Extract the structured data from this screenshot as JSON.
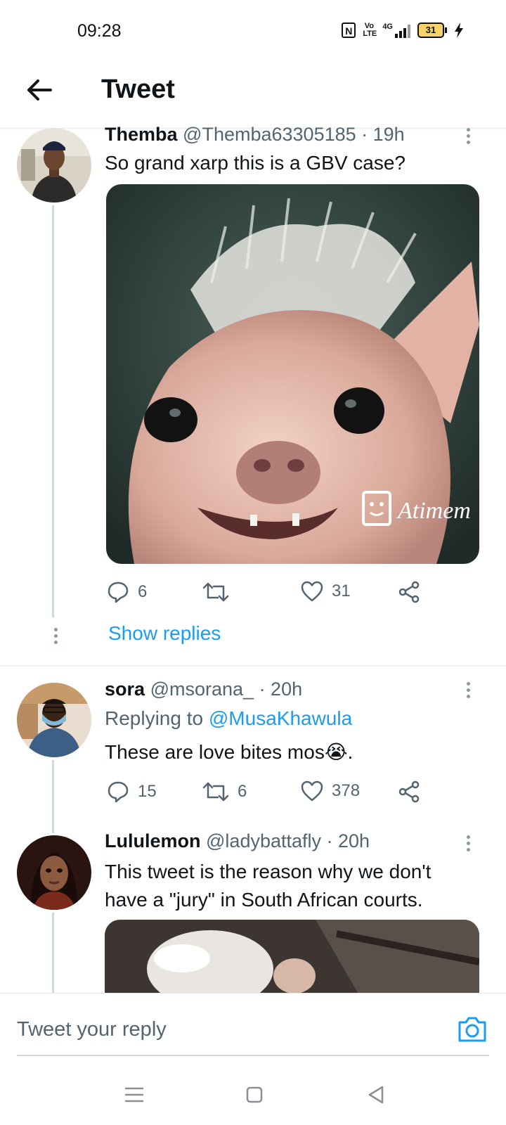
{
  "status_bar": {
    "time": "09:28",
    "nfc_label": "N",
    "volte_label": "Vo LTE",
    "network_label": "4G",
    "battery_level": "31",
    "icons": [
      "nfc-icon",
      "volte-icon",
      "signal-icon",
      "battery-icon",
      "charging-icon"
    ]
  },
  "header": {
    "title": "Tweet",
    "back_icon": "arrow-left-icon"
  },
  "tweets": [
    {
      "name": "Themba",
      "handle": "@Themba63305185",
      "time": "· 19h",
      "text": "So grand xarp this is a GBV case?",
      "media_watermark": "Atimem",
      "replies": "6",
      "retweets": "",
      "likes": "31",
      "show_replies": "Show replies"
    },
    {
      "name": "sora",
      "handle": "@msorana_",
      "time": "· 20h",
      "replying_prefix": "Replying to",
      "replying_to": "@MusaKhawula",
      "text": "These are love bites mos😭.",
      "replies": "15",
      "retweets": "6",
      "likes": "378"
    },
    {
      "name": "Lululemon",
      "handle": "@ladybattafly",
      "time": "· 20h",
      "text": "This tweet is the reason why we don't have a \"jury\" in South African courts."
    }
  ],
  "reply_bar": {
    "placeholder": "Tweet your reply",
    "camera_icon": "camera-icon"
  },
  "nav_bar": {
    "icons": [
      "menu-icon",
      "home-square-icon",
      "back-triangle-icon"
    ]
  },
  "colors": {
    "accent": "#1d9bf0",
    "secondary_text": "#536471",
    "thread_line": "#cfd9de"
  }
}
